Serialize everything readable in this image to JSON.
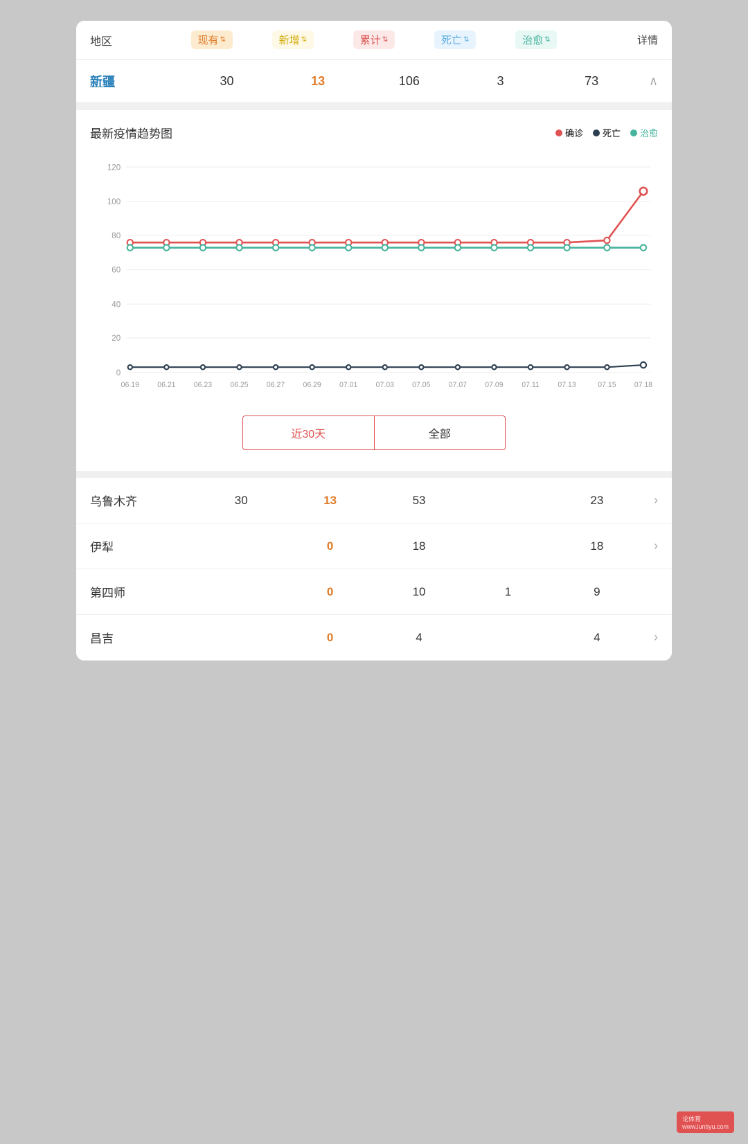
{
  "header": {
    "region_label": "地区",
    "current_label": "现有",
    "new_label": "新增",
    "total_label": "累计",
    "death_label": "死亡",
    "recover_label": "治愈",
    "detail_label": "详情"
  },
  "xinjiang": {
    "name": "新疆",
    "current": "30",
    "new": "13",
    "total": "106",
    "death": "3",
    "recover": "73"
  },
  "chart": {
    "title": "最新疫情趋势图",
    "legend_confirmed": "确诊",
    "legend_death": "死亡",
    "legend_recover": "治愈",
    "filter_30days": "近30天",
    "filter_all": "全部",
    "x_labels": [
      "06.19",
      "06.21",
      "06.23",
      "06.25",
      "06.27",
      "06.29",
      "07.01",
      "07.03",
      "07.05",
      "07.07",
      "07.09",
      "07.11",
      "07.13",
      "07.15",
      "07.18"
    ],
    "y_labels": [
      "120",
      "100",
      "80",
      "60",
      "40",
      "20",
      "0"
    ],
    "confirmed_data": [
      76,
      76,
      76,
      76,
      76,
      76,
      76,
      76,
      76,
      76,
      76,
      76,
      76,
      77,
      106
    ],
    "death_data": [
      3,
      3,
      3,
      3,
      3,
      3,
      3,
      3,
      3,
      3,
      3,
      3,
      3,
      3,
      3
    ],
    "recover_data": [
      73,
      73,
      73,
      73,
      73,
      73,
      73,
      73,
      73,
      73,
      73,
      73,
      73,
      73,
      73
    ]
  },
  "sub_regions": [
    {
      "name": "乌鲁木齐",
      "current": "30",
      "new": "13",
      "total": "53",
      "death": "",
      "recover": "23"
    },
    {
      "name": "伊犁",
      "current": "",
      "new": "0",
      "total": "18",
      "death": "",
      "recover": "18"
    },
    {
      "name": "第四师",
      "current": "",
      "new": "0",
      "total": "10",
      "death": "1",
      "recover": "9"
    },
    {
      "name": "昌吉",
      "current": "",
      "new": "0",
      "total": "4",
      "death": "",
      "recover": "4"
    }
  ],
  "watermark": {
    "brand": "论体育",
    "url": "www.luntiyu.com"
  }
}
